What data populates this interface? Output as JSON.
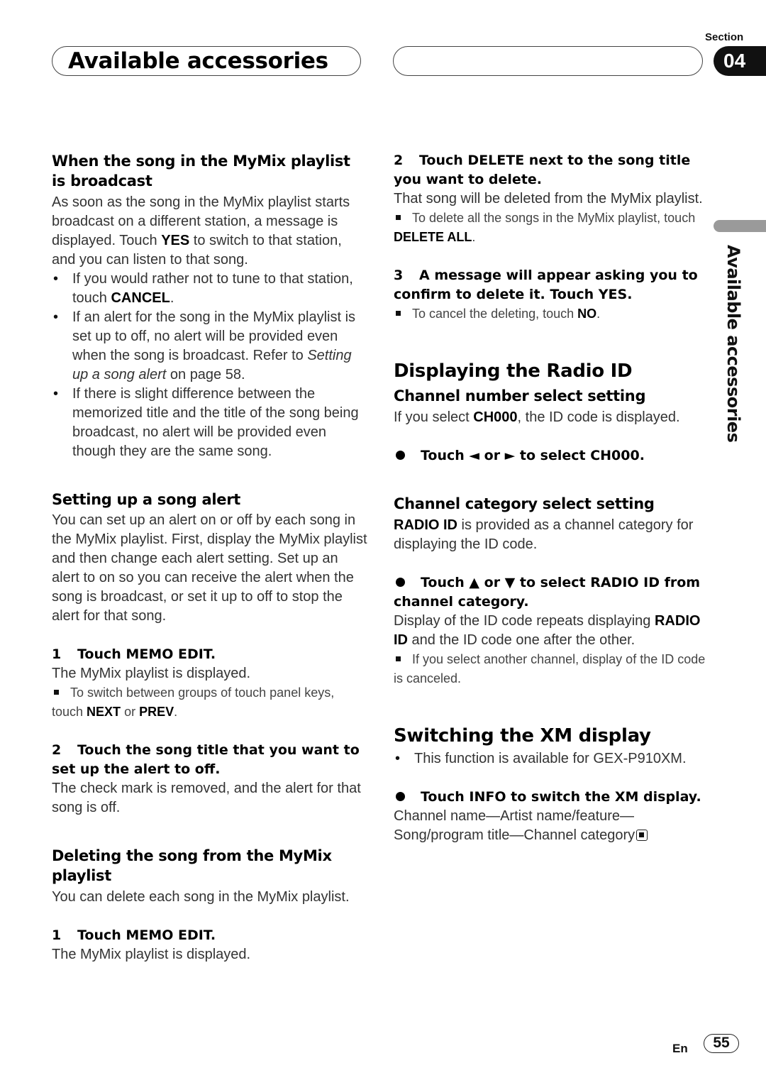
{
  "header": {
    "title": "Available accessories",
    "section_label": "Section",
    "section_number": "04",
    "side_label": "Available accessories"
  },
  "left": {
    "s1_title": "When the song in the MyMix playlist is broadcast",
    "s1_p1": "As soon as the song in the MyMix playlist starts broadcast on a different station, a message is displayed. Touch ",
    "s1_p1_bold": "YES",
    "s1_p1_end": " to switch to that station, and you can listen to that song.",
    "s1_b1_pre": "If you would rather not to tune to that station, touch ",
    "s1_b1_bold": "CANCEL",
    "s1_b1_end": ".",
    "s1_b2_pre": "If an alert for the song in the MyMix playlist is set up to off, no alert will be provided even when the song is broadcast. Refer to ",
    "s1_b2_italic": "Setting up a song alert",
    "s1_b2_end": " on page 58.",
    "s1_b3": "If there is slight difference between the memorized title and the title of the song being broadcast, no alert will be provided even though they are the same song.",
    "s2_title": "Setting up a song alert",
    "s2_p1": "You can set up an alert on or off by each song in the MyMix playlist. First, display the MyMix playlist and then change each alert setting. Set up an alert to on so you can receive the alert when the song is broadcast, or set it up to off to stop the alert for that song.",
    "s2_step1_num": "1",
    "s2_step1": "Touch MEMO EDIT.",
    "s2_step1_p": "The MyMix playlist is displayed.",
    "s2_step1_note_pre": "To switch between groups of touch panel keys, touch ",
    "s2_step1_note_b1": "NEXT",
    "s2_step1_note_mid": " or ",
    "s2_step1_note_b2": "PREV",
    "s2_step1_note_end": ".",
    "s2_step2_num": "2",
    "s2_step2": "Touch the song title that you want to set up the alert to off.",
    "s2_step2_p": "The check mark is removed, and the alert for that song is off.",
    "s3_title": "Deleting the song from the MyMix playlist",
    "s3_p1": "You can delete each song in the MyMix playlist.",
    "s3_step1_num": "1",
    "s3_step1": "Touch MEMO EDIT.",
    "s3_step1_p": "The MyMix playlist is displayed."
  },
  "right": {
    "step2_num": "2",
    "step2": "Touch DELETE next to the song title you want to delete.",
    "step2_p": "That song will be deleted from the MyMix playlist.",
    "step2_note_pre": "To delete all the songs in the MyMix playlist, touch ",
    "step2_note_bold": "DELETE ALL",
    "step2_note_end": ".",
    "step3_num": "3",
    "step3": "A message will appear asking you to confirm to delete it. Touch YES.",
    "step3_note_pre": "To cancel the deleting, touch ",
    "step3_note_bold": "NO",
    "step3_note_end": ".",
    "radio_title": "Displaying the Radio ID",
    "ch_num_title": "Channel number select setting",
    "ch_num_p_pre": "If you select ",
    "ch_num_p_bold": "CH000",
    "ch_num_p_end": ", the ID code is displayed.",
    "ch_num_step": "Touch ◄ or ► to select CH000.",
    "ch_cat_title": "Channel category select setting",
    "ch_cat_p_bold": "RADIO ID",
    "ch_cat_p_end": " is provided as a channel category for displaying the ID code.",
    "ch_cat_step": "Touch ▲ or ▼ to select RADIO ID from channel category.",
    "ch_cat_p2_pre": "Display of the ID code repeats displaying ",
    "ch_cat_p2_bold": "RADIO ID",
    "ch_cat_p2_end": " and the ID code one after the other.",
    "ch_cat_note": "If you select another channel, display of the ID code is canceled.",
    "xm_title": "Switching the XM display",
    "xm_bullet": "This function is available for GEX-P910XM.",
    "xm_step": "Touch INFO to switch the XM display.",
    "xm_p": "Channel name—Artist name/feature—Song/program title—Channel category"
  },
  "footer": {
    "lang": "En",
    "page": "55"
  }
}
